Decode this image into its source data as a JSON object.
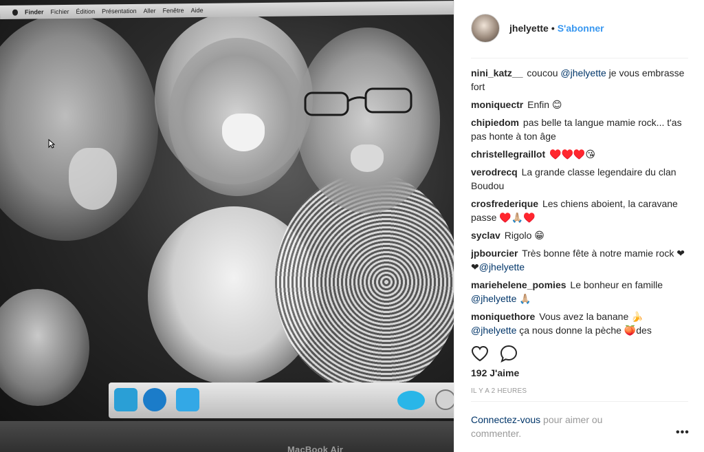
{
  "photo": {
    "menubar": {
      "items": [
        "Finder",
        "Fichier",
        "Édition",
        "Présentation",
        "Aller",
        "Fenêtre",
        "Aide"
      ]
    },
    "bezel_label": "MacBook Air"
  },
  "post": {
    "username": "jhelyette",
    "separator": "•",
    "follow_label": "S'abonner",
    "comments": [
      {
        "user": "nini_katz__",
        "parts": [
          {
            "t": "coucou "
          },
          {
            "t": "@jhelyette",
            "m": true
          },
          {
            "t": " je vous embrasse fort"
          }
        ]
      },
      {
        "user": "moniquectr",
        "parts": [
          {
            "t": "Enfin 😊"
          }
        ]
      },
      {
        "user": "chipiedom",
        "parts": [
          {
            "t": "pas belle ta langue mamie rock... t'as pas honte à ton âge"
          }
        ]
      },
      {
        "user": "christellegraillot",
        "parts": [
          {
            "t": "♥️♥️♥️😘"
          }
        ]
      },
      {
        "user": "verodrecq",
        "parts": [
          {
            "t": "La grande classe legendaire du clan Boudou"
          }
        ]
      },
      {
        "user": "crosfrederique",
        "parts": [
          {
            "t": "Les chiens aboient, la caravane passe ♥️🙏🏼♥️"
          }
        ]
      },
      {
        "user": "syclav",
        "parts": [
          {
            "t": "Rigolo 😁"
          }
        ]
      },
      {
        "user": "jpbourcier",
        "parts": [
          {
            "t": "Très bonne fête à notre mamie rock ❤❤"
          },
          {
            "t": "@jhelyette",
            "m": true
          }
        ]
      },
      {
        "user": "mariehelene_pomies",
        "parts": [
          {
            "t": "Le bonheur en famille "
          },
          {
            "t": "@jhelyette",
            "m": true
          },
          {
            "t": " 🙏🏼"
          }
        ]
      },
      {
        "user": "moniquethore",
        "parts": [
          {
            "t": "Vous avez la banane 🍌 "
          },
          {
            "t": "@jhelyette",
            "m": true
          },
          {
            "t": " ça nous donne la pèche 🍑des"
          }
        ]
      }
    ],
    "likes_label": "192 J'aime",
    "time_label": "IL Y A 2 HEURES",
    "login": {
      "link_label": "Connectez-vous",
      "rest_label": " pour aimer ou commenter."
    },
    "more_label": "•••"
  },
  "icons": {
    "like": "heart-icon",
    "comment": "comment-bubble-icon",
    "more": "more-options-icon"
  },
  "colors": {
    "link_blue": "#3897f0",
    "mention_blue": "#003569",
    "text": "#262626",
    "muted": "#999999"
  }
}
